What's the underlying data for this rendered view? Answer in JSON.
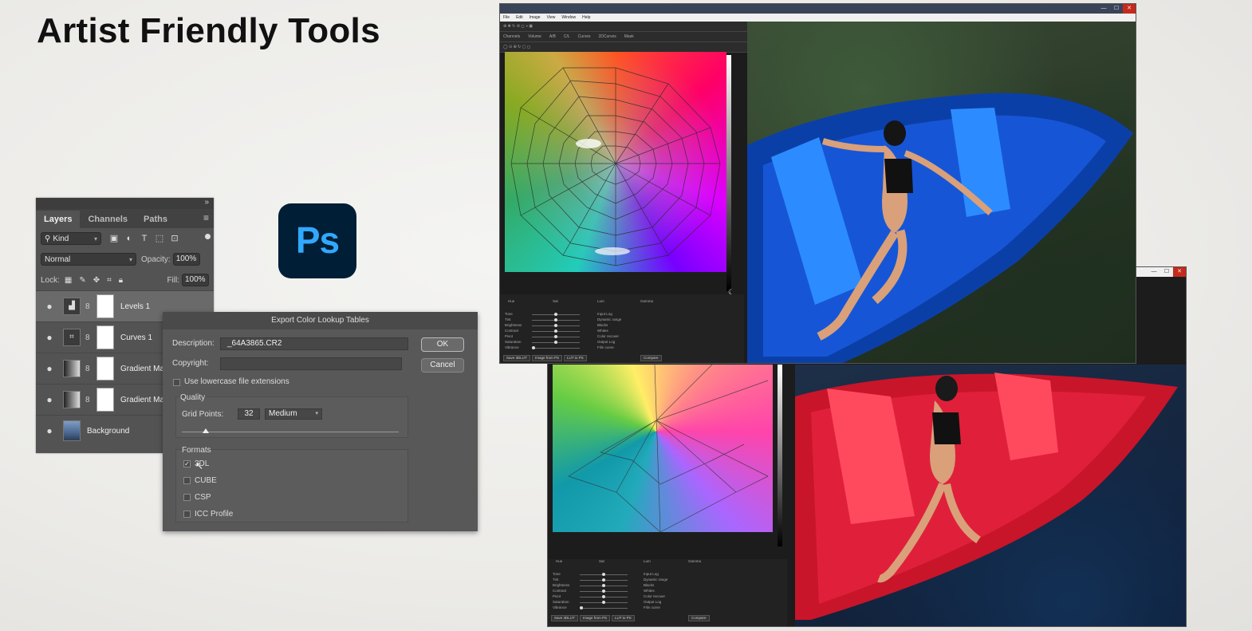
{
  "slide": {
    "title": "Artist Friendly Tools"
  },
  "layers_panel": {
    "tabs": [
      "Layers",
      "Channels",
      "Paths"
    ],
    "filter_kind": "Kind",
    "blend_mode": "Normal",
    "opacity_label": "Opacity:",
    "opacity_value": "100%",
    "lock_label": "Lock:",
    "fill_label": "Fill:",
    "fill_value": "100%",
    "layers": [
      {
        "name": "Levels 1",
        "selected": true
      },
      {
        "name": "Curves 1",
        "selected": false
      },
      {
        "name": "Gradient Ma",
        "selected": false
      },
      {
        "name": "Gradient Ma",
        "selected": false
      },
      {
        "name": "Background",
        "selected": false
      }
    ]
  },
  "ps_logo": {
    "text": "Ps"
  },
  "export_dialog": {
    "title": "Export Color Lookup Tables",
    "description_label": "Description:",
    "description_value": "_64A3865.CR2",
    "copyright_label": "Copyright:",
    "copyright_value": "",
    "lowercase_label": "Use lowercase file extensions",
    "lowercase_checked": false,
    "quality_label": "Quality",
    "grid_points_label": "Grid Points:",
    "grid_points_value": "32",
    "quality_preset": "Medium",
    "formats_label": "Formats",
    "formats": [
      {
        "label": "3DL",
        "checked": true
      },
      {
        "label": "CUBE",
        "checked": false
      },
      {
        "label": "CSP",
        "checked": false
      },
      {
        "label": "ICC Profile",
        "checked": false
      }
    ],
    "ok_label": "OK",
    "cancel_label": "Cancel"
  },
  "lut_windows": {
    "menu": [
      "File",
      "Edit",
      "Image",
      "View",
      "Window",
      "Help"
    ],
    "toolbar_tabs": [
      "Channels",
      "Volume",
      "A/B",
      "C/L",
      "Curves",
      "2DCurves",
      "Mask"
    ],
    "bottom_labels": [
      "Hue",
      "Sat",
      "Lum",
      "Gamma"
    ],
    "adjust_labels": [
      "Tone",
      "Tint",
      "Brightness",
      "Contrast",
      "Pivot",
      "Saturation",
      "Vibrance"
    ],
    "right_labels": [
      "Input Log",
      "Dynamic range",
      "Blacks",
      "Whites",
      "Color recover",
      "Output Log",
      "Film curve"
    ],
    "buttons": [
      "Save 3DLUT",
      "Image from PS",
      "LUT to PS",
      "Compare"
    ]
  }
}
